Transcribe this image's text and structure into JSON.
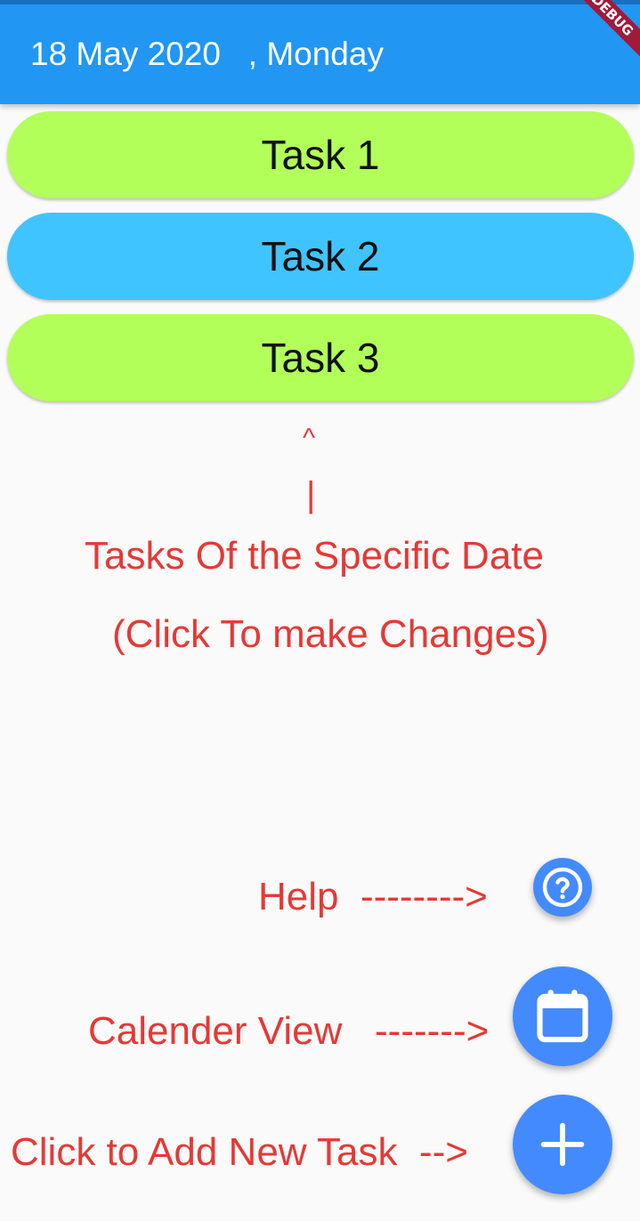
{
  "app_bar": {
    "title": "18 May 2020   , Monday",
    "debug_banner": "DEBUG"
  },
  "tasks": [
    {
      "label": "Task 1",
      "color": "#b2ff59"
    },
    {
      "label": "Task 2",
      "color": "#40c4ff"
    },
    {
      "label": "Task 3",
      "color": "#b2ff59"
    }
  ],
  "annotations": {
    "caret": "^",
    "bar": "|",
    "tasks_line1": "Tasks Of the Specific Date",
    "tasks_line2": "(Click To make Changes)",
    "help": "Help  -------->",
    "calendar": "Calender View   ------->",
    "add": "Click to Add New Task  -->"
  },
  "fabs": {
    "help_icon": "help-icon",
    "calendar_icon": "calendar-icon",
    "add_icon": "add-icon"
  },
  "colors": {
    "app_bar": "#2196f3",
    "fab": "#448aff",
    "annotation": "#e53935"
  }
}
